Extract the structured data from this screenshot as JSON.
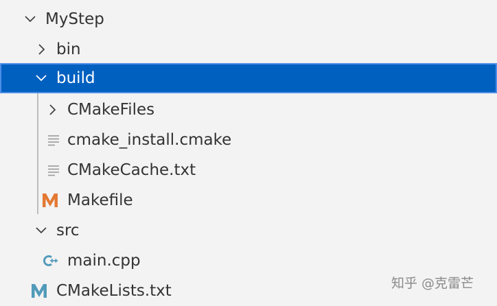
{
  "explorer": {
    "items": [
      {
        "label": "MyStep",
        "icon": "chevron-down-icon",
        "depth": 0,
        "expanded": true
      },
      {
        "label": "bin",
        "icon": "chevron-right-icon",
        "depth": 1,
        "expanded": false
      },
      {
        "label": "build",
        "icon": "chevron-down-icon",
        "depth": 1,
        "expanded": true,
        "selected": true
      },
      {
        "label": "CMakeFiles",
        "icon": "chevron-right-icon",
        "depth": 2,
        "expanded": false
      },
      {
        "label": "cmake_install.cmake",
        "icon": "text-file-icon",
        "depth": 2
      },
      {
        "label": "CMakeCache.txt",
        "icon": "text-file-icon",
        "depth": 2
      },
      {
        "label": "Makefile",
        "icon": "makefile-m-icon",
        "depth": 2
      },
      {
        "label": "src",
        "icon": "chevron-down-icon",
        "depth": 1,
        "expanded": true
      },
      {
        "label": "main.cpp",
        "icon": "cpp-file-icon",
        "depth": 2
      },
      {
        "label": "CMakeLists.txt",
        "icon": "makefile-m-icon",
        "depth": 1
      }
    ]
  },
  "colors": {
    "background": "#f3f3f3",
    "selection": "#0060c0",
    "selection_border": "#4d8ee8",
    "makefile_orange": "#e37933",
    "cmake_blue": "#519aba",
    "text": "#333333"
  },
  "watermark": "知乎 @克雷芒"
}
